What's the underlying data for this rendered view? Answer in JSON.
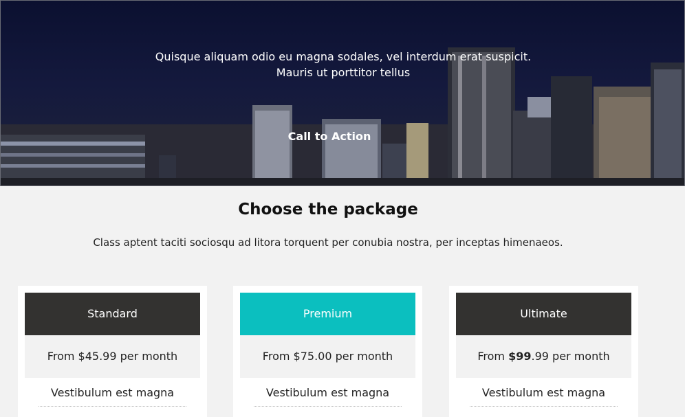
{
  "hero": {
    "line1": "Quisque aliquam odio eu magna sodales, vel interdum erat suspicit.",
    "line2": "Mauris ut porttitor tellus",
    "cta_label": "Call to Action"
  },
  "pricing": {
    "title": "Choose the package",
    "subtitle": "Class aptent taciti sociosqu ad litora torquent per conubia nostra, per inceptas himenaeos.",
    "plans": [
      {
        "name": "Standard",
        "price_prefix": "From ",
        "price_bold": "",
        "price_rest": "$45.99 per month",
        "feature": "Vestibulum est magna",
        "color": "#333230"
      },
      {
        "name": "Premium",
        "price_prefix": "From ",
        "price_bold": "",
        "price_rest": "$75.00 per month",
        "feature": "Vestibulum est magna",
        "color": "#0bbfbf"
      },
      {
        "name": "Ultimate",
        "price_prefix": "From ",
        "price_bold": "$99",
        "price_rest": ".99 per month",
        "feature": "Vestibulum est magna",
        "color": "#333230"
      }
    ]
  }
}
